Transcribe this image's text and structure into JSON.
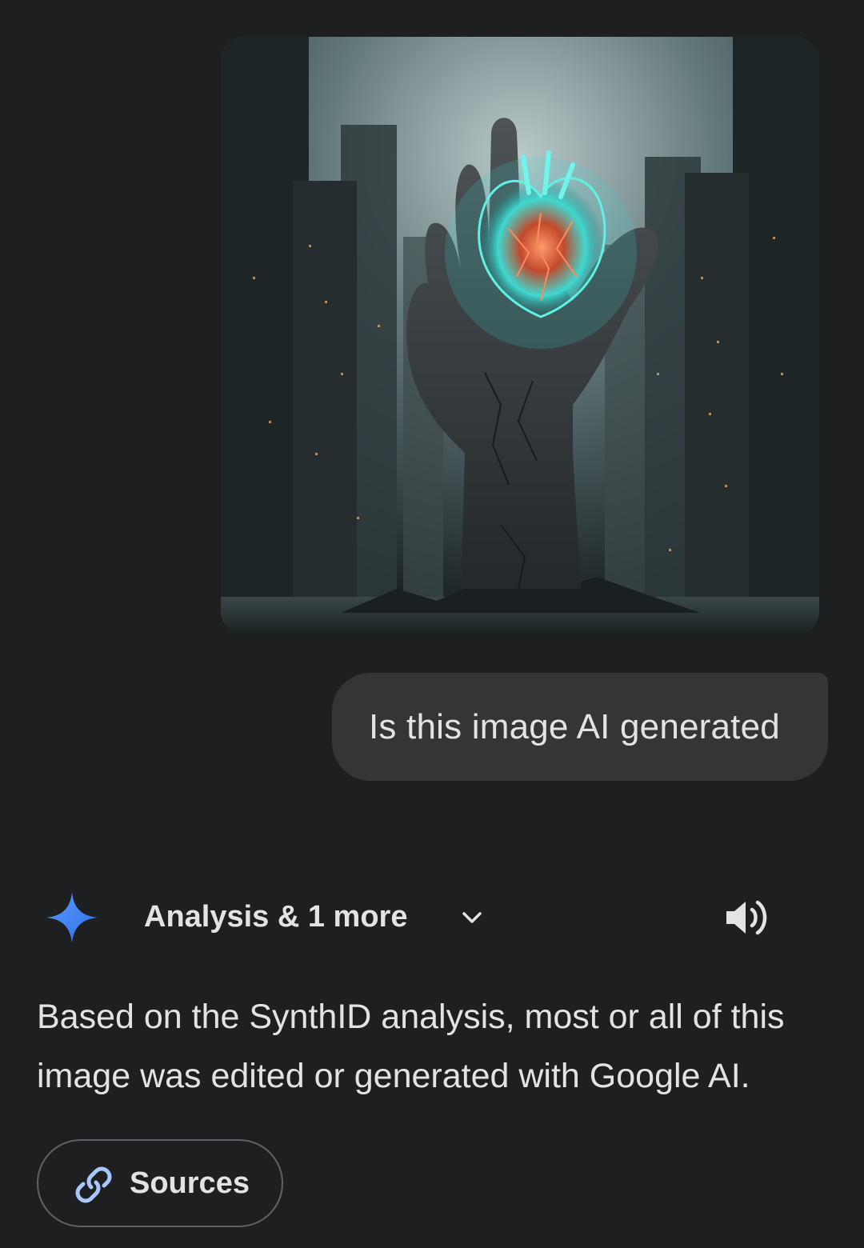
{
  "attachment": {
    "alt": "AI-style image of a giant stone hand holding a glowing cyan heart among dark skyscrapers"
  },
  "prompt": {
    "text": "Is this image AI generated"
  },
  "response": {
    "tools_label": "Analysis & 1 more",
    "body": "Based on the SynthID analysis, most or all of this image was edited or generated with Google AI.",
    "sources_label": "Sources"
  },
  "icons": {
    "spark": "gemini-spark-icon",
    "chevron": "chevron-down-icon",
    "speaker": "speaker-icon",
    "link": "link-icon"
  },
  "colors": {
    "background": "#1e1f20",
    "bubble": "#333537",
    "text": "#e3e3e3",
    "spark_blue": "#4285f4",
    "link_blue": "#a8c7fa",
    "chip_border": "#5f6368"
  }
}
